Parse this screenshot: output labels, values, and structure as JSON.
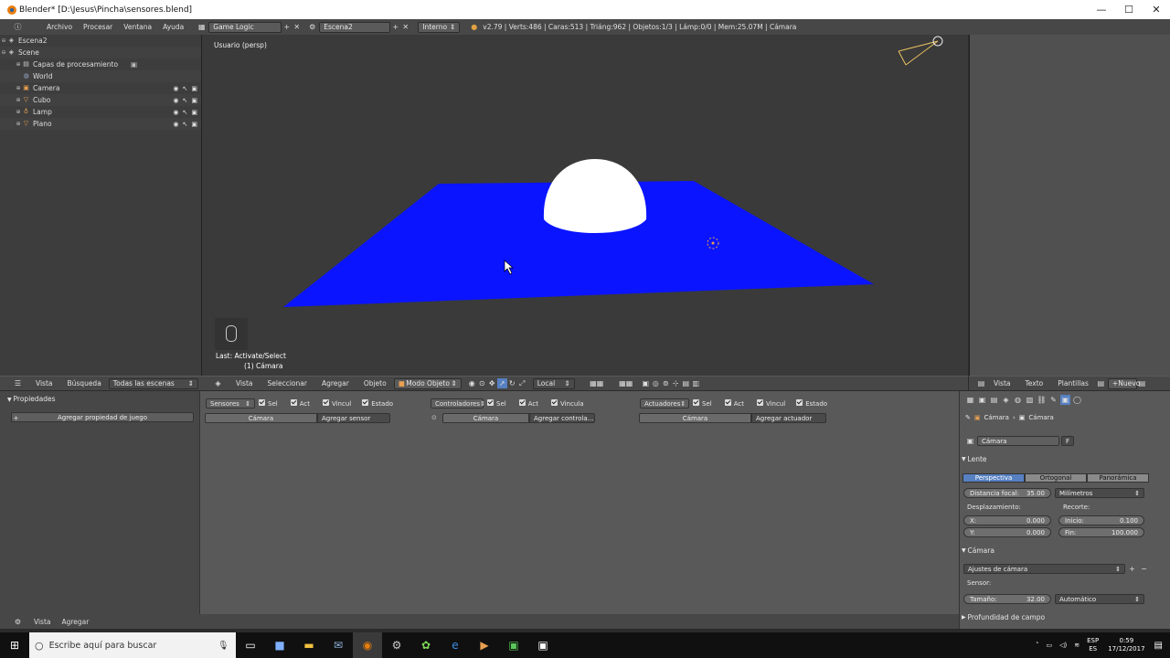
{
  "window": {
    "title": "Blender* [D:\\Jesus\\Pincha\\sensores.blend]",
    "controls": [
      "—",
      "☐",
      "✕"
    ]
  },
  "info_header": {
    "menus": [
      "Archivo",
      "Procesar",
      "Ventana",
      "Ayuda"
    ],
    "screen_layout": "Game Logic",
    "scene": "Escena2",
    "engine": "Interno",
    "stats": "v2.79 | Verts:486 | Caras:513 | Triáng:962 | Objetos:1/3 | Lámp:0/0 | Mem:25.07M | Cámara"
  },
  "outliner": {
    "items": [
      {
        "label": "Escena2",
        "icon": "scene-icon"
      },
      {
        "label": "Scene",
        "icon": "scene-icon"
      },
      {
        "label": "Capas de procesamiento",
        "icon": "render-layers-icon"
      },
      {
        "label": "World",
        "icon": "world-icon"
      },
      {
        "label": "Camera",
        "icon": "camera-icon"
      },
      {
        "label": "Cubo",
        "icon": "mesh-icon"
      },
      {
        "label": "Lamp",
        "icon": "lamp-icon"
      },
      {
        "label": "Plano",
        "icon": "mesh-icon"
      }
    ],
    "header": {
      "menus": [
        "Vista",
        "Búsqueda"
      ],
      "filter": "Todas las escenas"
    }
  },
  "viewport": {
    "view_label": "Usuario (persp)",
    "last_op": "Last: Activate/Select",
    "active_object": "(1) Cámara",
    "header": {
      "menus": [
        "Vista",
        "Seleccionar",
        "Agregar",
        "Objeto"
      ],
      "mode": "Modo Objeto",
      "orientation": "Local"
    },
    "colors": {
      "background": "#3a3a3a",
      "plane": "#0a14ff",
      "dome": "#ffffff"
    }
  },
  "text_editor": {
    "header": {
      "menus": [
        "Vista",
        "Texto",
        "Plantillas"
      ],
      "new_label": "Nuevo"
    }
  },
  "logic_editor": {
    "properties_title": "Propiedades",
    "add_property": "Agregar propiedad de juego",
    "sensors": {
      "label": "Sensores",
      "checks": [
        "Sel",
        "Act",
        "Vincul",
        "Estado"
      ],
      "object": "Cámara",
      "add": "Agregar sensor"
    },
    "controllers": {
      "label": "Controladores",
      "checks": [
        "Sel",
        "Act",
        "Vincula"
      ],
      "object": "Cámara",
      "add": "Agregar controla..."
    },
    "actuators": {
      "label": "Actuadores",
      "checks": [
        "Sel",
        "Act",
        "Vincul",
        "Estado"
      ],
      "object": "Cámara",
      "add": "Agregar actuador"
    },
    "footer_menus": [
      "Vista",
      "Agregar"
    ]
  },
  "properties": {
    "breadcrumb": [
      "Cámara",
      "Cámara"
    ],
    "datablock": "Cámara",
    "fake_user": "F",
    "lens_panel": "Lente",
    "projection": [
      "Perspectiva",
      "Ortogonal",
      "Panorámica"
    ],
    "focal_label": "Distancia focal:",
    "focal_value": "35.00",
    "focal_unit": "Milímetros",
    "shift_label": "Desplazamiento:",
    "clip_label": "Recorte:",
    "shift_x_label": "X:",
    "shift_x": "0.000",
    "shift_y_label": "Y:",
    "shift_y": "0.000",
    "clip_start_label": "Inicio:",
    "clip_start": "0.100",
    "clip_end_label": "Fin:",
    "clip_end": "100.000",
    "camera_panel": "Cámara",
    "presets": "Ajustes de cámara",
    "sensor_label": "Sensor:",
    "sensor_size_label": "Tamaño:",
    "sensor_size": "32.00",
    "sensor_fit": "Automático",
    "dof_panel": "Profundidad de campo"
  },
  "taskbar": {
    "search_placeholder": "Escribe aquí para buscar",
    "lang": "ESP",
    "region": "ES",
    "time": "0:59",
    "date": "17/12/2017"
  }
}
